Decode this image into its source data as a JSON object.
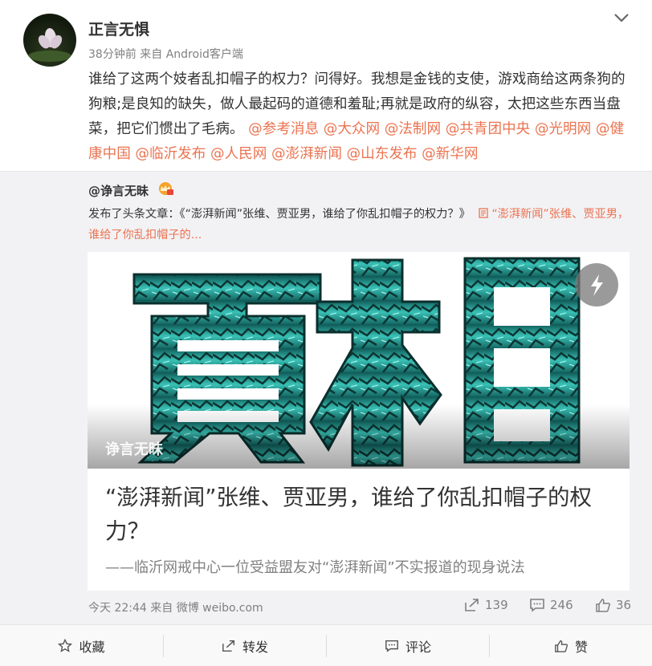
{
  "post": {
    "author": "正言无惧",
    "meta": "38分钟前 来自 Android客户端",
    "text": "谁给了这两个妓者乱扣帽子的权力？问得好。我想是金钱的支使，游戏商给这两条狗的狗粮;是良知的缺失，做人最起码的道德和羞耻;再就是政府的纵容，太把这些东西当盘菜，把它们惯出了毛病。",
    "mentions": [
      "@参考消息",
      "@大众网",
      "@法制网",
      "@共青团中央",
      "@光明网",
      "@健康中国",
      "@临沂发布",
      "@人民网",
      "@澎湃新闻",
      "@山东发布",
      "@新华网"
    ]
  },
  "repost": {
    "user": "@诤言无昧",
    "text": "发布了头条文章：《“澎湃新闻”张维、贾亚男，谁给了你乱扣帽子的权力？》",
    "link_label": "“澎湃新闻”张维、贾亚男，谁给了你乱扣帽子的...",
    "card": {
      "cover_text": "真相",
      "watermark": "诤言无昧",
      "title": "“澎湃新闻”张维、贾亚男，谁给了你乱扣帽子的权力？",
      "subtitle": "——临沂网戒中心一位受益盟友对“澎湃新闻”不实报道的现身说法"
    },
    "footer": {
      "time_source": "今天 22:44 来自 微博 weibo.com",
      "forwards": "139",
      "comments": "246",
      "likes": "36"
    }
  },
  "actions": {
    "favorite": "收藏",
    "forward": "转发",
    "comment": "评论",
    "like": "赞"
  },
  "colors": {
    "link": "#eb7350",
    "muted": "#808080",
    "repost_bg": "#f2f2f5",
    "cover_teal": "#2fb3aa"
  }
}
